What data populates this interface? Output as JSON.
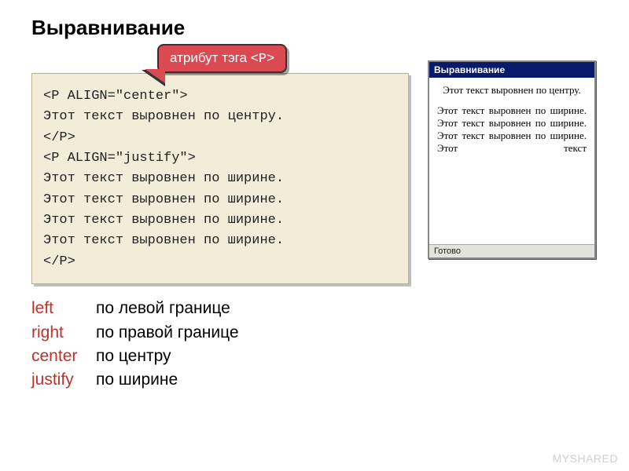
{
  "title": "Выравнивание",
  "callout": {
    "prefix": "атрибут тэга ",
    "tag": "<P>"
  },
  "code": {
    "l1": "<P ALIGN=\"center\">",
    "l2": "Этот текст выровнен по центру.",
    "l3": "</P>",
    "l4": "<P ALIGN=\"justify\">",
    "l5": "Этот текст выровнен по ширине.",
    "l6": "Этот текст выровнен по ширине.",
    "l7": "Этот текст выровнен по ширине.",
    "l8": "Этот текст выровнен по ширине.",
    "l9": "</P>"
  },
  "browser": {
    "title": "Выравнивание",
    "center": "Этот текст выровнен по центру.",
    "justify": "Этот текст выровнен по ширине. Этот текст выровнен по ширине. Этот текст выровнен по ширине. Этот текст",
    "status": "Готово"
  },
  "legend": {
    "items": [
      {
        "key": "left",
        "val": "по левой границе"
      },
      {
        "key": "right",
        "val": "по правой границе"
      },
      {
        "key": "center",
        "val": "по центру"
      },
      {
        "key": "justify",
        "val": "по ширине"
      }
    ]
  },
  "watermark": "MYSHARED"
}
